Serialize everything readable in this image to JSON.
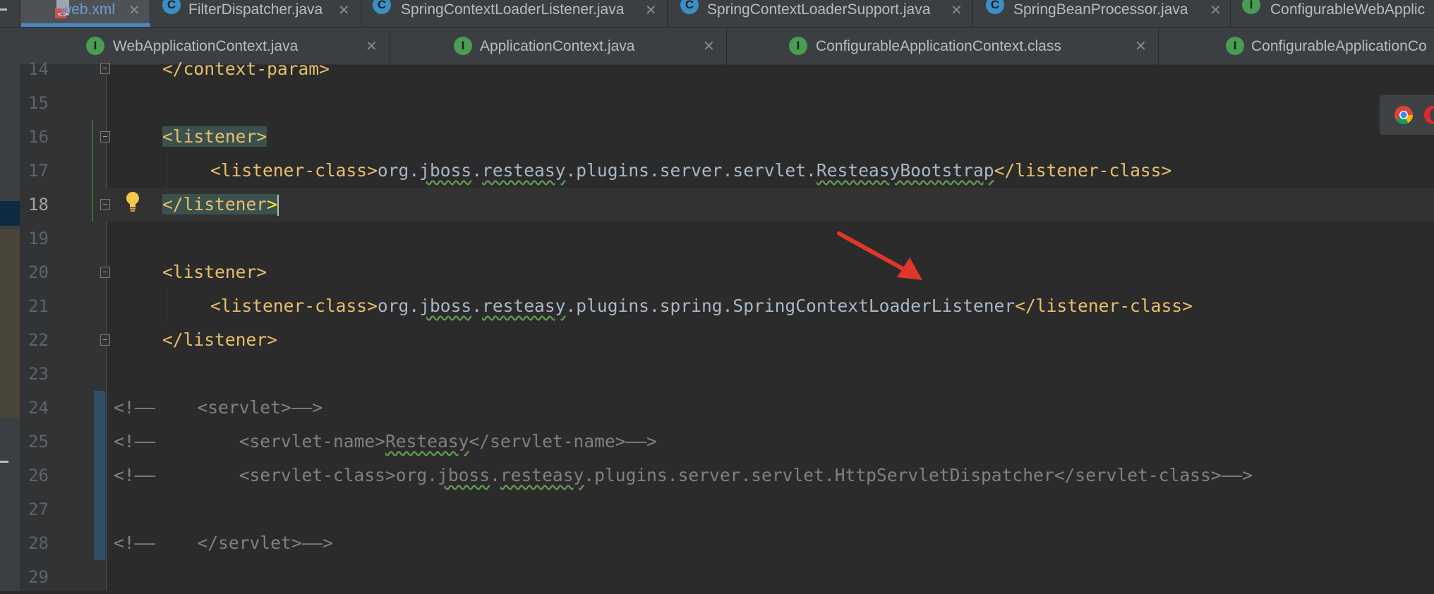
{
  "tabs_row1": [
    {
      "label": "web.xml",
      "icon": "xml-file-icon",
      "active": true
    },
    {
      "label": "FilterDispatcher.java",
      "icon": "class-icon"
    },
    {
      "label": "SpringContextLoaderListener.java",
      "icon": "class-icon"
    },
    {
      "label": "SpringContextLoaderSupport.java",
      "icon": "class-icon"
    },
    {
      "label": "SpringBeanProcessor.java",
      "icon": "class-icon"
    },
    {
      "label": "ConfigurableWebApplic",
      "icon": "interface-icon"
    }
  ],
  "tabs_row2": [
    {
      "label": "WebApplicationContext.java",
      "icon": "interface-icon"
    },
    {
      "label": "ApplicationContext.java",
      "icon": "interface-icon"
    },
    {
      "label": "ConfigurableApplicationContext.class",
      "icon": "interface-icon"
    },
    {
      "label": "ConfigurableApplicationCo",
      "icon": "interface-icon"
    }
  ],
  "icon_letters": {
    "class": "C",
    "interface": "I"
  },
  "close_glyph": "✕",
  "editor": {
    "line_numbers": [
      "14",
      "15",
      "16",
      "17",
      "18",
      "19",
      "20",
      "21",
      "22",
      "23",
      "24",
      "25",
      "26",
      "27",
      "28",
      "29"
    ],
    "current_line": "18",
    "lines": {
      "l14": "</context-param>",
      "l16": "<listener>",
      "l17_open": "<listener-class>",
      "l17_pkg1": "org.",
      "l17_jboss": "jboss",
      "l17_dot": ".",
      "l17_resteasy": "resteasy",
      "l17_rest": ".plugins.server.servlet.",
      "l17_cls": "ResteasyBootstrap",
      "l17_close": "</listener-class>",
      "l18": "</listener",
      "l18_end": ">",
      "l20": "<listener>",
      "l21_open": "<listener-class>",
      "l21_pkg1": "org.",
      "l21_jboss": "jboss",
      "l21_dot": ".",
      "l21_resteasy": "resteasy",
      "l21_rest": ".plugins.spring.SpringContextLoaderListener",
      "l21_close": "</listener-class>",
      "l22": "</listener>",
      "l24_pre": "<!——",
      "l24_body": "    <servlet>——>",
      "l25_pre": "<!——",
      "l25_a": "        <servlet-name>",
      "l25_b": "Resteasy",
      "l25_c": "</servlet-name>——>",
      "l26_pre": "<!——",
      "l26_a": "        <servlet-class>org.",
      "l26_jboss": "jboss",
      "l26_dot": ".",
      "l26_resteasy": "resteasy",
      "l26_b": ".plugins.server.servlet.HttpServletDispatcher</servlet-class>——>",
      "l28_pre": "<!——",
      "l28_body": "    </servlet>——>"
    }
  },
  "colors": {
    "editor_bg": "#2b2b2b",
    "tag": "#e8bf6a",
    "text": "#a9b7c6",
    "comment": "#808080",
    "arrow": "#e0362a"
  },
  "browser_icons": [
    "chrome-icon",
    "opera-icon"
  ]
}
